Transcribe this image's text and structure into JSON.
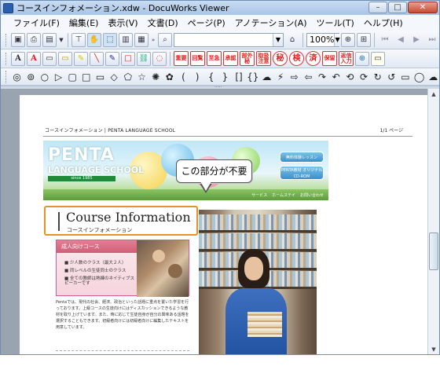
{
  "window": {
    "title": "コースインフォメーション.xdw - DocuWorks Viewer",
    "buttons": {
      "minimize": "–",
      "maximize": "□",
      "close": "✕"
    }
  },
  "menu": [
    "ファイル(F)",
    "編集(E)",
    "表示(V)",
    "文書(D)",
    "ページ(P)",
    "アノテーション(A)",
    "ツール(T)",
    "ヘルプ(H)"
  ],
  "toolbar": {
    "page_input": "",
    "zoom": "100%"
  },
  "stamps": [
    "重要",
    "回覧",
    "至急",
    "承認",
    "社外秘",
    "取扱注意",
    "秘",
    "検",
    "済",
    "保留",
    "処理済",
    "済み"
  ],
  "stamps_shown": {
    "s1": "重要",
    "s2": "回覧",
    "s3": "至急",
    "s4": "承認",
    "s5": "部外秘",
    "s6": "取扱注意",
    "s7": "秘",
    "s8": "検",
    "s9": "済",
    "s10": "保留",
    "s11": "返信入力"
  },
  "document": {
    "header_left": "コースインフォメーション | PENTA LANGUAGE SCHOOL",
    "header_right": "1/1 ページ",
    "banner": {
      "title": "PENTA",
      "subtitle": "LANGUAGE SCHOOL",
      "since": "since 1985",
      "btn1": "無料体験レッスン",
      "btn2": "PENTA教材 オリジナル CD-ROM",
      "nav": [
        "サービス",
        "ホームステイ",
        "お問い合わせ"
      ]
    },
    "callout": "この部分が不要",
    "course_title": "Course Information",
    "course_subtitle": "コースインフォメーション",
    "adult_box": {
      "heading": "成人向けコース",
      "items": [
        "少人数のクラス（最大２人）",
        "同レベルの生徒同士のクラス",
        "全ての教師は熟練のネイティブスピーカーです"
      ]
    },
    "paragraph": "Pentaでは、現代の社会、経済、政治といった話題に重点を置いた学習を行っております。上級コースの生徒向けにはディスカッションできるような教材を取り上げています。また、時に応じて生徒自身が自分の興味ある話題を選択することもできます。初級者向けには初級者向けに編集したテキストを用意しています。"
  }
}
